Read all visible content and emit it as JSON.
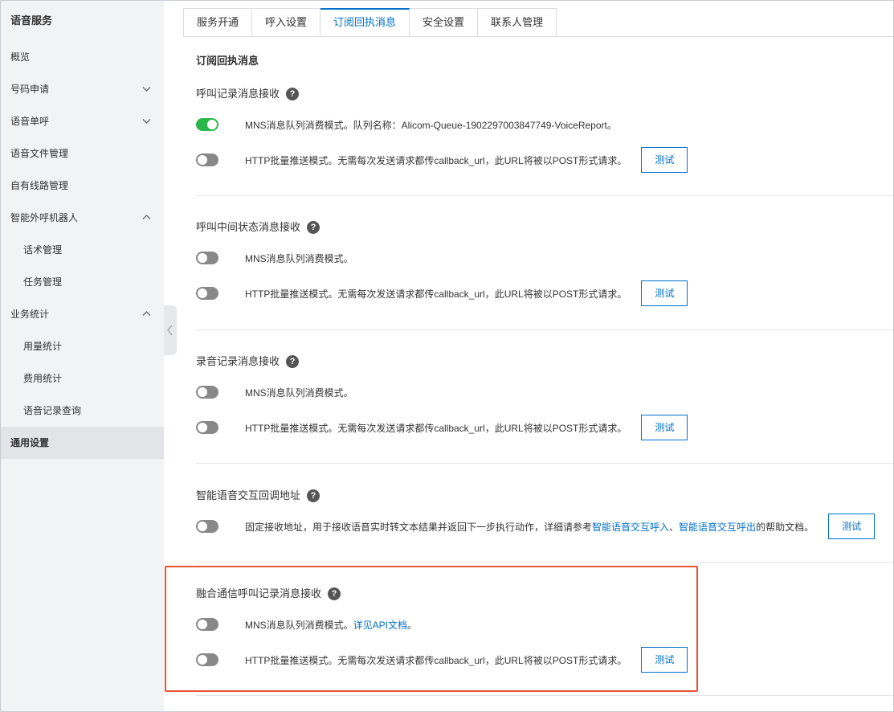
{
  "sidebar": {
    "title": "语音服务",
    "items": [
      {
        "label": "概览"
      },
      {
        "label": "号码申请"
      },
      {
        "label": "语音单呼"
      },
      {
        "label": "语音文件管理"
      },
      {
        "label": "自有线路管理"
      },
      {
        "label": "智能外呼机器人"
      },
      {
        "label": "话术管理"
      },
      {
        "label": "任务管理"
      },
      {
        "label": "业务统计"
      },
      {
        "label": "用量统计"
      },
      {
        "label": "费用统计"
      },
      {
        "label": "语音记录查询"
      },
      {
        "label": "通用设置"
      }
    ]
  },
  "tabs": [
    {
      "label": "服务开通"
    },
    {
      "label": "呼入设置"
    },
    {
      "label": "订阅回执消息"
    },
    {
      "label": "安全设置"
    },
    {
      "label": "联系人管理"
    }
  ],
  "page_title": "订阅回执消息",
  "sections": [
    {
      "title": "呼叫记录消息接收",
      "mns": "MNS消息队列消费模式。队列名称：Alicom-Queue-1902297003847749-VoiceReport。",
      "http": "HTTP批量推送模式。无需每次发送请求都传callback_url，此URL将被以POST形式请求。",
      "button": "测试"
    },
    {
      "title": "呼叫中间状态消息接收",
      "mns": "MNS消息队列消费模式。",
      "http": "HTTP批量推送模式。无需每次发送请求都传callback_url，此URL将被以POST形式请求。",
      "button": "测试"
    },
    {
      "title": "录音记录消息接收",
      "mns": "MNS消息队列消费模式。",
      "http": "HTTP批量推送模式。无需每次发送请求都传callback_url，此URL将被以POST形式请求。",
      "button": "测试"
    },
    {
      "title": "智能语音交互回调地址",
      "desc_prefix": "固定接收地址，用于接收语音实时转文本结果并返回下一步执行动作，详细请参考",
      "link1": "智能语音交互呼入",
      "sep": "、",
      "link2": "智能语音交互呼出",
      "desc_suffix": "的帮助文档。",
      "button": "测试"
    },
    {
      "title": "融合通信呼叫记录消息接收",
      "mns": "MNS消息队列消费模式。",
      "mns_link": "详见API文档",
      "mns_suffix": "。",
      "http": "HTTP批量推送模式。无需每次发送请求都传callback_url，此URL将被以POST形式请求。",
      "button": "测试"
    }
  ],
  "help_glyph": "?",
  "colors": {
    "accent": "#0070cc",
    "toggle_on": "#2bb74a",
    "highlight": "#e8542f"
  }
}
